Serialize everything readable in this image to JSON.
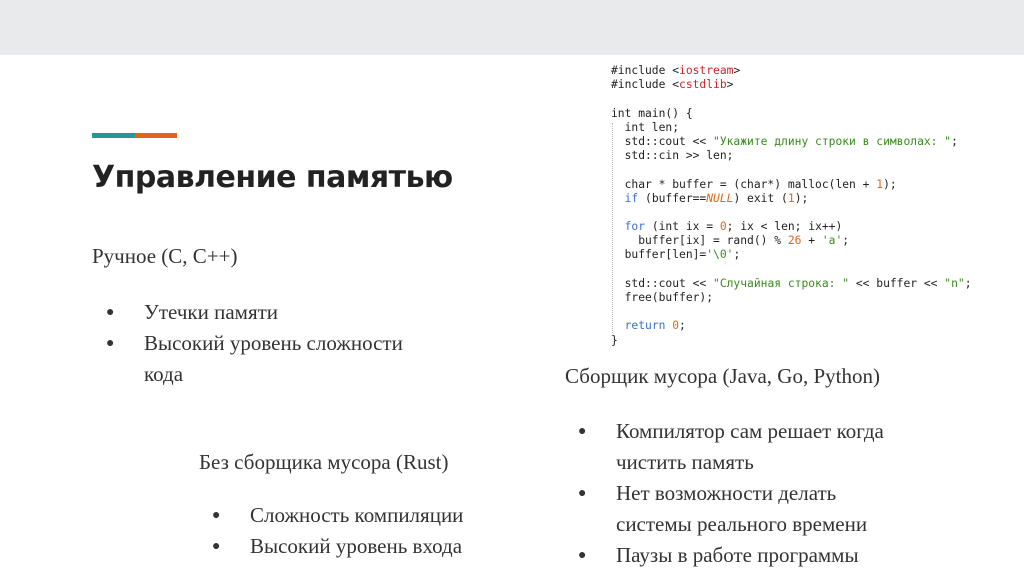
{
  "slide": {
    "title": "Управление памятью",
    "manual": {
      "heading": "Ручное (C, C++)",
      "bullets": [
        "Утечки памяти",
        "Высокий уровень сложности",
        "кода"
      ]
    },
    "rust": {
      "heading": "Без сборщика мусора (Rust)",
      "bullets": [
        "Сложность компиляции",
        "Высокий уровень входа"
      ]
    },
    "gc": {
      "heading": "Сборщик мусора (Java, Go, Python)",
      "bullets": [
        "Компилятор сам решает когда",
        "чистить память",
        "Нет возможности делать",
        "системы реального времени",
        "Паузы в работе программы"
      ]
    },
    "bullet_glyph": "●",
    "colors": {
      "accent_teal": "#1f9a95",
      "accent_orange": "#e8611a",
      "code_string": "#3a8a1e",
      "code_number": "#e2661a",
      "code_keyword": "#3a6fd8",
      "code_include": "#d2222d"
    }
  },
  "code": {
    "l1a": "#include <",
    "l1b": "iostream",
    "l1c": ">",
    "l2a": "#include <",
    "l2b": "cstdlib",
    "l2c": ">",
    "l3": "int main() {",
    "l4": "  int len;",
    "l5a": "  std::cout << ",
    "l5b": "\"Укажите длину строки в символах: \"",
    "l5c": ";",
    "l6": "  std::cin >> len;",
    "l7a": "  char * buffer = (char*) malloc(len + ",
    "l7b": "1",
    "l7c": ");",
    "l8a": "if",
    "l8b": " (buffer==",
    "l8c": "NULL",
    "l8d": ") exit (",
    "l8e": "1",
    "l8f": ");",
    "l9a": "for",
    "l9b": " (int ix = ",
    "l9c": "0",
    "l9d": "; ix < len; ix++)",
    "l10a": "    buffer[ix] = rand() % ",
    "l10b": "26",
    "l10c": " + ",
    "l10d": "'a'",
    "l10e": ";",
    "l11a": "  buffer[len]=",
    "l11b": "'\\0'",
    "l11c": ";",
    "l12a": "  std::cout << ",
    "l12b": "\"Случайная строка: \"",
    "l12c": " << buffer << ",
    "l12d": "\"n\"",
    "l12e": ";",
    "l13": "  free(buffer);",
    "l14a": "return",
    "l14b": "0",
    "l14c": ";",
    "l15": "}"
  }
}
